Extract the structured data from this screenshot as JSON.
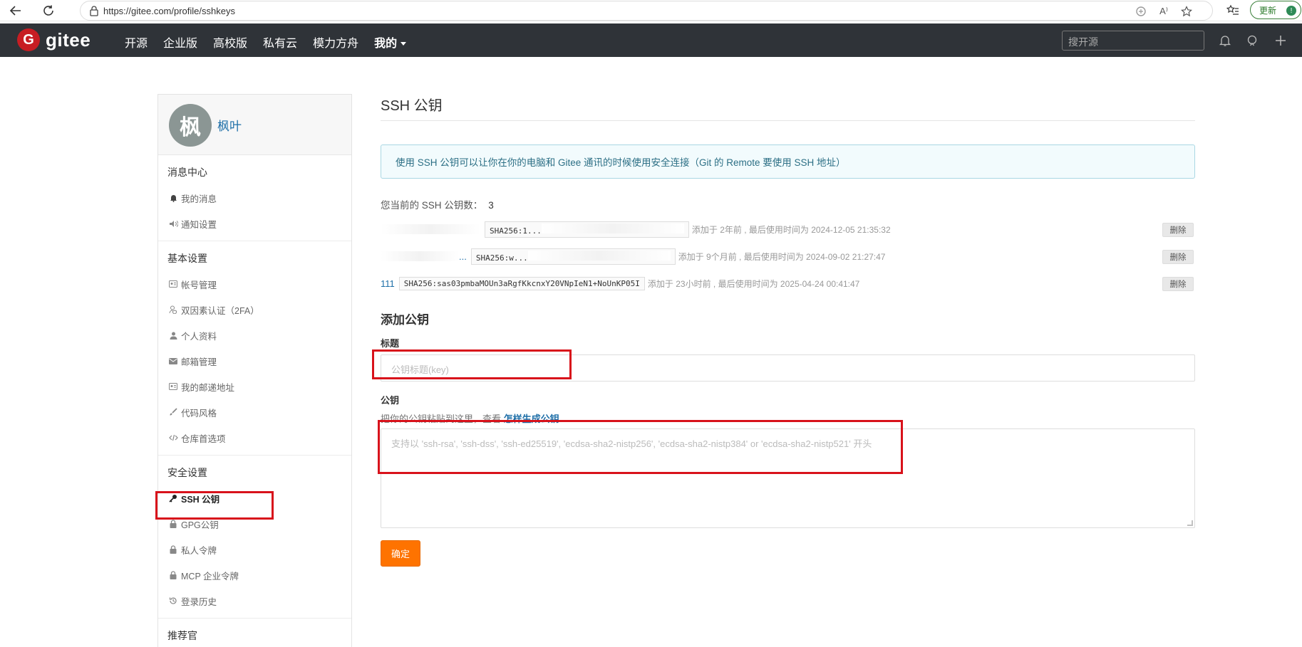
{
  "browser": {
    "url": "https://gitee.com/profile/sshkeys",
    "update_label": "更新",
    "update_badge": "!",
    "read_aloud_label": "A⁾"
  },
  "header": {
    "logo_text": "gitee",
    "logo_letter": "G",
    "nav": [
      "开源",
      "企业版",
      "高校版",
      "私有云",
      "模力方舟",
      "我的"
    ],
    "search_placeholder": "搜开源"
  },
  "sidebar": {
    "avatar_char": "枫",
    "username": "枫叶",
    "groups": [
      {
        "title": "消息中心",
        "items": [
          {
            "label": "我的消息",
            "icon": "bell-icon"
          },
          {
            "label": "通知设置",
            "icon": "speaker-icon"
          }
        ]
      },
      {
        "title": "基本设置",
        "items": [
          {
            "label": "帐号管理",
            "icon": "id-card-icon"
          },
          {
            "label": "双因素认证（2FA）",
            "icon": "user-shield-icon"
          },
          {
            "label": "个人资料",
            "icon": "user-icon"
          },
          {
            "label": "邮箱管理",
            "icon": "envelope-icon"
          },
          {
            "label": "我的邮递地址",
            "icon": "address-card-icon"
          },
          {
            "label": "代码风格",
            "icon": "brush-icon"
          },
          {
            "label": "仓库首选项",
            "icon": "code-icon"
          }
        ]
      },
      {
        "title": "安全设置",
        "items": [
          {
            "label": "SSH 公钥",
            "icon": "key-icon",
            "active": true
          },
          {
            "label": "GPG公钥",
            "icon": "lock-icon"
          },
          {
            "label": "私人令牌",
            "icon": "lock-icon"
          },
          {
            "label": "MCP 企业令牌",
            "icon": "lock-icon"
          },
          {
            "label": "登录历史",
            "icon": "history-icon"
          }
        ]
      },
      {
        "title": "推荐官",
        "items": []
      }
    ]
  },
  "main": {
    "title": "SSH 公钥",
    "info": "使用 SSH 公钥可以让你在你的电脑和 Gitee 通讯的时候使用安全连接（Git 的 Remote 要使用 SSH 地址）",
    "count_label": "您当前的 SSH 公钥数：",
    "count_value": "3",
    "keys": [
      {
        "title": "",
        "fingerprint": "SHA256:1...",
        "meta": "添加于 2年前 , 最后使用时间为 2024-12-05 21:35:32",
        "delete": "删除"
      },
      {
        "title": "...",
        "fingerprint": "SHA256:w...",
        "meta": "添加于 9个月前 , 最后使用时间为 2024-09-02 21:27:47",
        "delete": "删除"
      },
      {
        "title": "111",
        "fingerprint": "SHA256:sas03pmbaMOUn3aRgfKkcnxY20VNpIeN1+NoUnKP05I",
        "meta": "添加于 23小时前 , 最后使用时间为 2025-04-24 00:41:47",
        "delete": "删除"
      }
    ],
    "add_title": "添加公钥",
    "field_title_label": "标题",
    "field_title_placeholder": "公钥标题(key)",
    "field_key_label": "公钥",
    "field_key_hint": "把你的公钥粘贴到这里，查看",
    "field_key_hint_link": "怎样生成公钥",
    "field_key_placeholder": "支持以 'ssh-rsa', 'ssh-dss', 'ssh-ed25519', 'ecdsa-sha2-nistp256', 'ecdsa-sha2-nistp384' or 'ecdsa-sha2-nistp521' 开头",
    "submit": "确定"
  },
  "colors": {
    "brand_red": "#c71d23",
    "nav_bg": "#2f3338",
    "link": "#1e6fa8",
    "submit_orange": "#fe7300",
    "highlight_red": "#d8121b"
  }
}
